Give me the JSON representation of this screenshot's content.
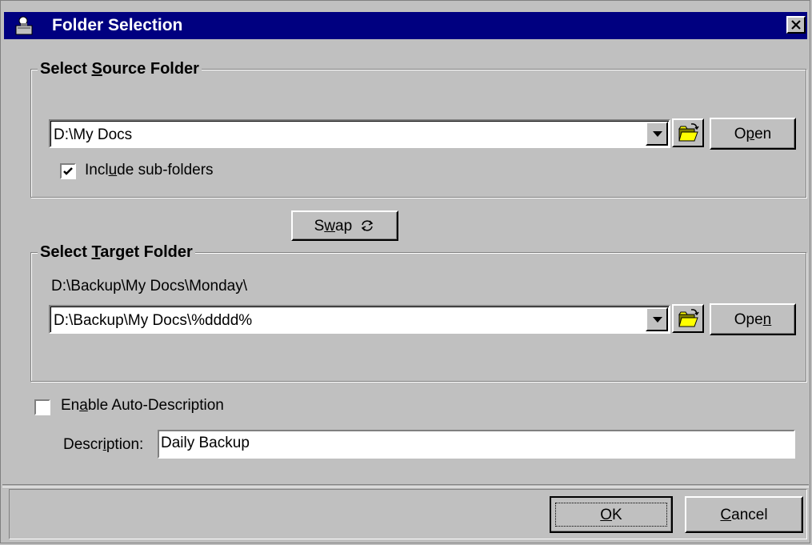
{
  "window": {
    "title": "Folder Selection"
  },
  "source": {
    "legend_pre": "Select ",
    "legend_key": "S",
    "legend_post": "ource Folder",
    "path": "D:\\My Docs",
    "open_pre": "O",
    "open_key": "p",
    "open_post": "en",
    "include_pre": "Incl",
    "include_key": "u",
    "include_post": "de sub-folders",
    "include_checked": true
  },
  "swap": {
    "pre": "S",
    "key": "w",
    "post": "ap"
  },
  "target": {
    "legend_pre": "Select ",
    "legend_key": "T",
    "legend_post": "arget Folder",
    "resolved_path": "D:\\Backup\\My Docs\\Monday\\",
    "path": "D:\\Backup\\My Docs\\%dddd%",
    "open_pre": "Ope",
    "open_key": "n",
    "open_post": ""
  },
  "auto_desc": {
    "pre": "En",
    "key": "a",
    "post": "ble Auto-Description",
    "checked": false
  },
  "description": {
    "label_pre": "Descr",
    "label_key": "i",
    "label_post": "ption:",
    "value": "Daily Backup"
  },
  "footer": {
    "ok_key": "O",
    "ok_post": "K",
    "cancel_key": "C",
    "cancel_post": "ancel"
  }
}
